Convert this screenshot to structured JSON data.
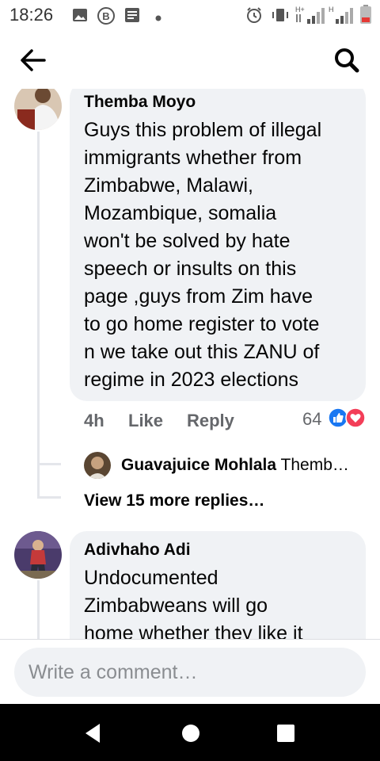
{
  "status_bar": {
    "time": "18:26",
    "left_icons": [
      "image-icon",
      "b-circle-icon",
      "news-icon",
      "dot-icon"
    ],
    "right_icons": [
      "alarm-icon",
      "vibrate-icon",
      "signal-h-plus-icon",
      "signal-h-icon",
      "battery-low-icon"
    ],
    "net_label_1": "H+",
    "net_label_2": "H"
  },
  "app_bar": {
    "back_icon": "arrow-left-icon",
    "search_icon": "search-icon"
  },
  "comments": [
    {
      "author": "Themba Moyo",
      "text": "Guys this problem of illegal\nimmigrants whether  from\nZimbabwe, Malawi,\nMozambique, somalia\nwon't be solved by hate\nspeech or insults on this\npage ,guys from Zim have\nto go home register to vote\nn we take out this ZANU of\nregime in 2023 elections",
      "time": "4h",
      "like_label": "Like",
      "reply_label": "Reply",
      "reaction_count": "64",
      "reactions": [
        "like-reaction-icon",
        "love-reaction-icon"
      ],
      "reply_preview": {
        "author": "Guavajuice Mohlala",
        "snippet": "Themb…"
      },
      "more_replies": "View 15 more replies…"
    },
    {
      "author": "Adivhaho Adi",
      "text": "Undocumented\nZimbabweans will go\nhome whether they like it"
    }
  ],
  "composer": {
    "placeholder": "Write a comment…"
  },
  "nav_bar": {
    "icons": [
      "back-triangle-icon",
      "home-circle-icon",
      "recents-square-icon"
    ]
  },
  "colors": {
    "bubble": "#f0f2f5",
    "meta_text": "#65676b",
    "like_blue": "#1877f2",
    "love_red": "#f33e58"
  }
}
